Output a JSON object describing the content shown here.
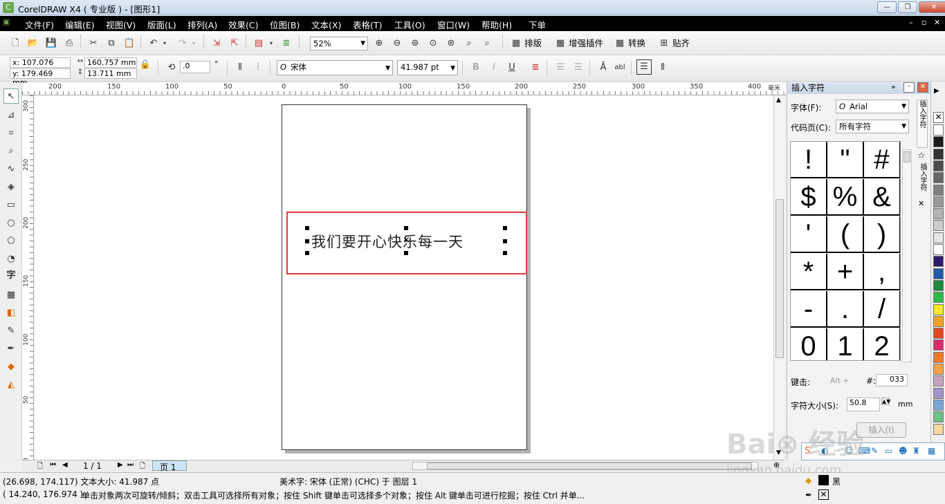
{
  "app": {
    "title": "CorelDRAW X4 ( 专业版 ) - [图形1]",
    "icon": "coreldraw-logo"
  },
  "window": {
    "minimize": "—",
    "restore": "❐",
    "close": "✕"
  },
  "menu": {
    "items": [
      "文件(F)",
      "编辑(E)",
      "视图(V)",
      "版面(L)",
      "排列(A)",
      "效果(C)",
      "位图(B)",
      "文本(X)",
      "表格(T)",
      "工具(O)",
      "窗口(W)",
      "帮助(H)",
      "下单"
    ]
  },
  "toolbar1": {
    "zoom": "52%",
    "buttons": [
      "排版",
      "增强插件",
      "转换",
      "贴齐"
    ]
  },
  "toolbar2": {
    "x": "x: 107.076 mm",
    "y": "y: 179.469 mm",
    "w": "160.757 mm",
    "h": "13.711 mm",
    "angle": ".0",
    "degree": "°",
    "font": "宋体",
    "size": "41.987 pt"
  },
  "rulers": {
    "h": [
      {
        "v": "200",
        "p": 38
      },
      {
        "v": "150",
        "p": 123
      },
      {
        "v": "100",
        "p": 207
      },
      {
        "v": "50",
        "p": 291
      },
      {
        "v": "0",
        "p": 375
      },
      {
        "v": "50",
        "p": 459
      },
      {
        "v": "100",
        "p": 544
      },
      {
        "v": "150",
        "p": 628
      },
      {
        "v": "200",
        "p": 712
      },
      {
        "v": "250",
        "p": 796
      },
      {
        "v": "300",
        "p": 881
      },
      {
        "v": "350",
        "p": 965
      },
      {
        "v": "400",
        "p": 1049
      }
    ],
    "h_unit": "毫米",
    "v": [
      {
        "v": "300",
        "p": 12
      },
      {
        "v": "250",
        "p": 97
      },
      {
        "v": "200",
        "p": 181
      },
      {
        "v": "150",
        "p": 265
      },
      {
        "v": "100",
        "p": 350
      },
      {
        "v": "50",
        "p": 434
      },
      {
        "v": "0",
        "p": 518
      }
    ]
  },
  "canvas": {
    "art_text": "我们要开心快乐每一天"
  },
  "nav": {
    "page": "1 / 1",
    "tab": "页 1"
  },
  "docker": {
    "title": "插入字符",
    "font_label": "字体(F):",
    "font_value": "Arial",
    "codepage_label": "代码页(C):",
    "codepage_value": "所有字符",
    "chars": [
      "!",
      "\"",
      "#",
      "$",
      "%",
      "&",
      "'",
      "(",
      ")",
      "*",
      "+",
      ",",
      "-",
      ".",
      "/",
      "0",
      "1",
      "2"
    ],
    "key_label": "键击:",
    "key_value": "Alt +",
    "hash_label": "#:",
    "hash_value": "033",
    "size_label": "字符大小(S):",
    "size_value": "50.8",
    "size_unit": "mm",
    "insert_button": "插入(I)",
    "side_tab1": "插入字符",
    "side_tab2": "插入字符"
  },
  "palette": [
    "#ffffff",
    "#1a1a1a",
    "#333333",
    "#4d4d4d",
    "#666666",
    "#808080",
    "#999999",
    "#b3b3b3",
    "#cccccc",
    "#e6e6e6",
    "#ffffff",
    "#2e1a6e",
    "#1e5aa8",
    "#1b8a3c",
    "#2dbb4a",
    "#f5e72a",
    "#f2a21e",
    "#e8451e",
    "#e02a6b",
    "#f07a2a",
    "#f4a24a",
    "#c8a0c0",
    "#a094c8",
    "#7aa6d6",
    "#6fc08a",
    "#f5d9a0"
  ],
  "status": {
    "coords": "(26.698, 174.117) 文本大小: 41.987 点",
    "object": "美术字: 宋体 (正常) (CHC) 于 图层 1",
    "coords2": "( 14.240, 176.974 )",
    "hint": "单击对象两次可旋转/倾斜；双击工具可选择所有对象；按住 Shift 键单击可选择多个对象；按住 Alt 键单击可进行挖掘；按住 Ctrl 并单...",
    "fill": "黑"
  },
  "watermark": {
    "main": "Bai⊗ 经验",
    "sub": "jingyan.baidu.com"
  }
}
